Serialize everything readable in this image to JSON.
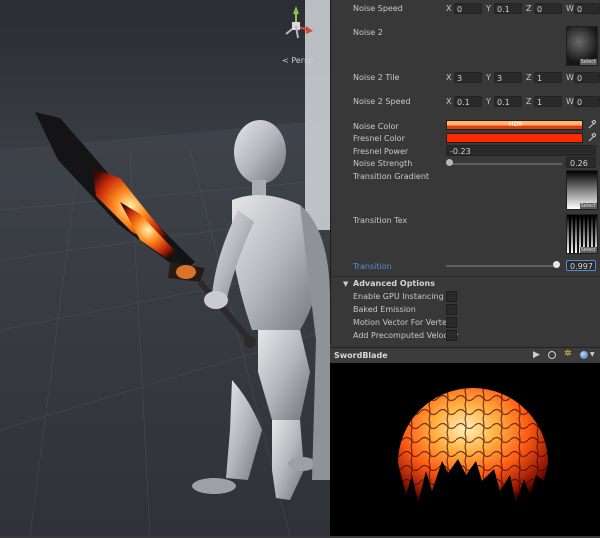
{
  "scene": {
    "gizmo_label": "< Persp",
    "gizmo_icon": "orientation-gizmo-icon"
  },
  "inspector": {
    "noise_speed": {
      "label": "Noise Speed",
      "x": "0",
      "y": "0.1",
      "z": "0",
      "w": "0"
    },
    "noise2": {
      "label": "Noise 2",
      "select": "Select"
    },
    "noise2_tile": {
      "label": "Noise 2 Tile",
      "x": "3",
      "y": "3",
      "z": "1",
      "w": "0"
    },
    "noise2_speed": {
      "label": "Noise 2 Speed",
      "x": "0.1",
      "y": "0.1",
      "z": "1",
      "w": "0"
    },
    "noise_color": {
      "label": "Noise Color",
      "badge": "HDR",
      "color_top": "#ffb870",
      "color_bottom": "#e83a10"
    },
    "fresnel_color": {
      "label": "Fresnel Color",
      "color": "#ff2a00"
    },
    "fresnel_power": {
      "label": "Fresnel Power",
      "value": "-0.23"
    },
    "noise_strength": {
      "label": "Noise Strength",
      "value": "0.26",
      "fraction": 0.0
    },
    "transition_gradient": {
      "label": "Transition Gradient",
      "select": "Select"
    },
    "transition_tex": {
      "label": "Transition Tex",
      "select": "Select"
    },
    "transition": {
      "label": "Transition",
      "value": "0.997",
      "fraction": 0.997
    },
    "advanced": {
      "title": "Advanced Options",
      "items": [
        "Enable GPU Instancing",
        "Baked Emission",
        "Motion Vector For Vertex A",
        "Add Precomputed Velocity"
      ]
    }
  },
  "preview": {
    "title": "SwordBlade",
    "icons": [
      "play-icon",
      "circle-icon",
      "light-icon",
      "sphere-icon"
    ]
  },
  "colors": {
    "accent": "#4f8fd9",
    "panel": "#383838",
    "field": "#2a2a2a"
  }
}
